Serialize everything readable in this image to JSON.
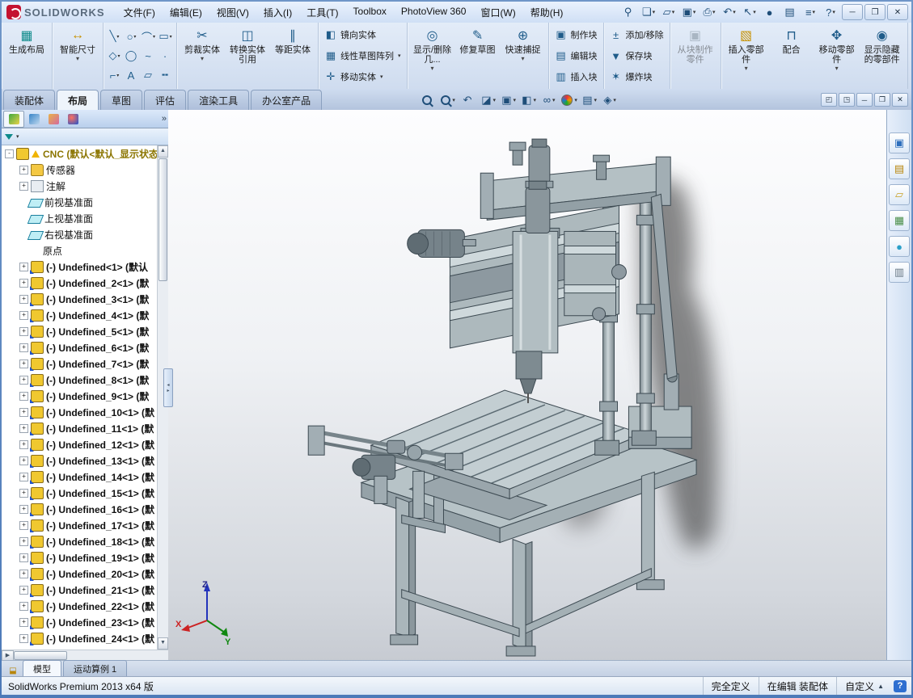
{
  "app": {
    "logo_text": "SOLIDWORKS"
  },
  "menubar": {
    "items": [
      {
        "label": "文件(F)",
        "name": "menu-file"
      },
      {
        "label": "编辑(E)",
        "name": "menu-edit"
      },
      {
        "label": "视图(V)",
        "name": "menu-view"
      },
      {
        "label": "插入(I)",
        "name": "menu-insert"
      },
      {
        "label": "工具(T)",
        "name": "menu-tools"
      },
      {
        "label": "Toolbox",
        "name": "menu-toolbox"
      },
      {
        "label": "PhotoView 360",
        "name": "menu-photoview"
      },
      {
        "label": "窗口(W)",
        "name": "menu-window"
      },
      {
        "label": "帮助(H)",
        "name": "menu-help"
      }
    ],
    "icons": [
      {
        "glyph": "⚲",
        "dd": "",
        "name": "pin-menu-icon"
      },
      {
        "glyph": "❏",
        "dd": "▾",
        "name": "new-document-icon"
      },
      {
        "glyph": "▱",
        "dd": "▾",
        "name": "open-document-icon"
      },
      {
        "glyph": "▣",
        "dd": "▾",
        "name": "save-icon"
      },
      {
        "glyph": "⎙",
        "dd": "▾",
        "name": "print-icon"
      },
      {
        "glyph": "↶",
        "dd": "▾",
        "name": "undo-icon"
      },
      {
        "glyph": "↖",
        "dd": "▾",
        "name": "select-arrow-icon"
      },
      {
        "glyph": "●",
        "dd": "",
        "name": "rebuild-icon"
      },
      {
        "glyph": "▤",
        "dd": "",
        "name": "file-properties-icon"
      },
      {
        "glyph": "≡",
        "dd": "▾",
        "name": "options-icon"
      },
      {
        "glyph": "?",
        "dd": "▾",
        "name": "help-icon"
      }
    ]
  },
  "ribbon": {
    "layout": [
      {
        "label": "生成布局",
        "icon": "▦",
        "iccls": "ict",
        "dd": "",
        "state": "",
        "name": "create-layout-button"
      }
    ],
    "dimension": [
      {
        "label": "智能尺寸",
        "icon": "↔",
        "iccls": "icy",
        "dd": "▾",
        "state": "",
        "name": "smart-dimension-button"
      }
    ],
    "sketch": [
      {
        "icon": "╲",
        "dd": "▾",
        "name": "line-tool"
      },
      {
        "icon": "○",
        "dd": "▾",
        "name": "circle-tool"
      },
      {
        "icon": "⌒",
        "dd": "▾",
        "name": "arc-tool"
      },
      {
        "icon": "▭",
        "dd": "▾",
        "name": "rectangle-tool"
      },
      {
        "icon": "◇",
        "dd": "▾",
        "name": "polygon-tool"
      },
      {
        "icon": "◯",
        "dd": "",
        "name": "ellipse-tool"
      },
      {
        "icon": "~",
        "dd": "",
        "name": "spline-tool"
      },
      {
        "icon": "·",
        "dd": "",
        "name": "point-tool"
      },
      {
        "icon": "⌐",
        "dd": "▾",
        "name": "sketch-fillet-tool"
      },
      {
        "icon": "A",
        "dd": "",
        "name": "text-tool"
      },
      {
        "icon": "▱",
        "dd": "",
        "name": "plane-tool"
      },
      {
        "icon": "╍",
        "dd": "",
        "name": "centerline-tool"
      }
    ],
    "modify": [
      {
        "label": "剪裁实体",
        "icon": "✂",
        "iccls": "",
        "dd": "▾",
        "state": "",
        "name": "trim-entities-button"
      },
      {
        "label": "转换实体引用",
        "icon": "◫",
        "iccls": "",
        "dd": "",
        "state": "",
        "name": "convert-entities-button"
      },
      {
        "label": "等距实体",
        "icon": "∥",
        "iccls": "",
        "dd": "",
        "state": "",
        "name": "offset-entities-button"
      }
    ],
    "pattern": [
      {
        "label": "镜向实体",
        "icon": "◧",
        "dd": "",
        "name": "mirror-entities-button"
      },
      {
        "label": "线性草图阵列",
        "icon": "▦",
        "dd": "▾",
        "name": "linear-sketch-pattern-button"
      },
      {
        "label": "移动实体",
        "icon": "✛",
        "dd": "▾",
        "name": "move-entities-button"
      }
    ],
    "display": [
      {
        "label": "显示/删除几...",
        "icon": "◎",
        "iccls": "",
        "dd": "▾",
        "state": "",
        "name": "display-delete-relations-button"
      },
      {
        "label": "修复草图",
        "icon": "✎",
        "iccls": "",
        "dd": "",
        "state": "",
        "name": "repair-sketch-button"
      },
      {
        "label": "快速捕捉",
        "icon": "⊕",
        "iccls": "",
        "dd": "▾",
        "state": "",
        "name": "quick-snaps-button"
      }
    ],
    "blocks1": [
      {
        "label": "制作块",
        "icon": "▣",
        "dd": "",
        "name": "make-block-button"
      },
      {
        "label": "编辑块",
        "icon": "▤",
        "dd": "",
        "name": "edit-block-button"
      },
      {
        "label": "插入块",
        "icon": "▥",
        "dd": "",
        "name": "insert-block-button"
      }
    ],
    "blocks2": [
      {
        "label": "添加/移除",
        "icon": "±",
        "dd": "",
        "name": "add-remove-button"
      },
      {
        "label": "保存块",
        "icon": "▼",
        "dd": "",
        "name": "save-block-button"
      },
      {
        "label": "爆炸块",
        "icon": "✶",
        "dd": "",
        "name": "explode-block-button"
      }
    ],
    "makepart": [
      {
        "label": "从块制作零件",
        "icon": "▣",
        "iccls": "icg",
        "dd": "",
        "state": "disabled",
        "name": "make-part-from-block-button"
      }
    ],
    "assembly": [
      {
        "label": "插入零部件",
        "icon": "▧",
        "iccls": "icy",
        "dd": "▾",
        "state": "",
        "name": "insert-components-button"
      },
      {
        "label": "配合",
        "icon": "⊓",
        "iccls": "",
        "dd": "",
        "state": "",
        "name": "mate-button"
      },
      {
        "label": "移动零部件",
        "icon": "✥",
        "iccls": "",
        "dd": "▾",
        "state": "",
        "name": "move-component-button"
      },
      {
        "label": "显示隐藏的零部件",
        "icon": "◉",
        "iccls": "",
        "dd": "",
        "state": "",
        "name": "show-hidden-components-button"
      }
    ]
  },
  "tabs": {
    "items": [
      {
        "label": "装配体",
        "state": "",
        "name": "tab-assembly"
      },
      {
        "label": "布局",
        "state": "active",
        "name": "tab-layout"
      },
      {
        "label": "草图",
        "state": "",
        "name": "tab-sketch"
      },
      {
        "label": "评估",
        "state": "",
        "name": "tab-evaluate"
      },
      {
        "label": "渲染工具",
        "state": "",
        "name": "tab-render-tools"
      },
      {
        "label": "办公室产品",
        "state": "",
        "name": "tab-office-products"
      }
    ]
  },
  "headsup": {
    "icons": [
      {
        "iccls": "mag",
        "glyph": "",
        "dd": "",
        "name": "zoom-fit-icon"
      },
      {
        "iccls": "mag",
        "glyph": "",
        "dd": "▾",
        "name": "zoom-area-icon"
      },
      {
        "iccls": "",
        "glyph": "↶",
        "dd": "",
        "name": "previous-view-icon"
      },
      {
        "iccls": "",
        "glyph": "◪",
        "dd": "▾",
        "name": "section-view-icon"
      },
      {
        "iccls": "",
        "glyph": "▣",
        "dd": "▾",
        "name": "view-orientation-icon"
      },
      {
        "iccls": "",
        "glyph": "◧",
        "dd": "▾",
        "name": "display-style-icon"
      },
      {
        "iccls": "",
        "glyph": "∞",
        "dd": "▾",
        "name": "hide-show-items-icon"
      },
      {
        "iccls": "ball",
        "glyph": "",
        "dd": "▾",
        "name": "edit-appearance-icon"
      },
      {
        "iccls": "",
        "glyph": "▤",
        "dd": "▾",
        "name": "apply-scene-icon"
      },
      {
        "iccls": "",
        "glyph": "◈",
        "dd": "▾",
        "name": "view-settings-icon"
      }
    ],
    "doc_controls": [
      {
        "glyph": "◰",
        "name": "split-pane-left-button"
      },
      {
        "glyph": "◳",
        "name": "split-pane-right-button"
      },
      {
        "glyph": "─",
        "name": "minimize-document-button"
      },
      {
        "glyph": "❐",
        "name": "restore-document-button"
      },
      {
        "glyph": "✕",
        "name": "close-document-button"
      }
    ]
  },
  "featuretree": {
    "root": "CNC (默认<默认_显示状态",
    "root_exp": "-",
    "items": [
      {
        "label": "传感器",
        "icon": "ic-sensors",
        "exp": "+",
        "cls": "",
        "name": "tree-item-sensors"
      },
      {
        "label": "注解",
        "icon": "ic-ann",
        "exp": "+",
        "cls": "",
        "name": "tree-item-annotations"
      },
      {
        "label": "前视基准面",
        "icon": "ic-plane",
        "exp": "",
        "cls": "",
        "name": "tree-item-front-plane"
      },
      {
        "label": "上视基准面",
        "icon": "ic-plane",
        "exp": "",
        "cls": "",
        "name": "tree-item-top-plane"
      },
      {
        "label": "右视基准面",
        "icon": "ic-plane",
        "exp": "",
        "cls": "",
        "name": "tree-item-right-plane"
      },
      {
        "label": "原点",
        "icon": "ic-origin",
        "exp": "",
        "cls": "",
        "name": "tree-item-origin"
      },
      {
        "label": "(-) Undefined<1> (默认",
        "icon": "ic-comp",
        "exp": "+",
        "cls": "comp",
        "name": "tree-item-component"
      },
      {
        "label": "(-) Undefined_2<1> (默",
        "icon": "ic-comp",
        "exp": "+",
        "cls": "comp",
        "name": "tree-item-component"
      },
      {
        "label": "(-) Undefined_3<1> (默",
        "icon": "ic-comp",
        "exp": "+",
        "cls": "comp",
        "name": "tree-item-component"
      },
      {
        "label": "(-) Undefined_4<1> (默",
        "icon": "ic-comp",
        "exp": "+",
        "cls": "comp",
        "name": "tree-item-component"
      },
      {
        "label": "(-) Undefined_5<1> (默",
        "icon": "ic-comp",
        "exp": "+",
        "cls": "comp",
        "name": "tree-item-component"
      },
      {
        "label": "(-) Undefined_6<1> (默",
        "icon": "ic-comp",
        "exp": "+",
        "cls": "comp",
        "name": "tree-item-component"
      },
      {
        "label": "(-) Undefined_7<1> (默",
        "icon": "ic-comp",
        "exp": "+",
        "cls": "comp",
        "name": "tree-item-component"
      },
      {
        "label": "(-) Undefined_8<1> (默",
        "icon": "ic-comp",
        "exp": "+",
        "cls": "comp",
        "name": "tree-item-component"
      },
      {
        "label": "(-) Undefined_9<1> (默",
        "icon": "ic-comp",
        "exp": "+",
        "cls": "comp",
        "name": "tree-item-component"
      },
      {
        "label": "(-) Undefined_10<1> (默",
        "icon": "ic-comp",
        "exp": "+",
        "cls": "comp",
        "name": "tree-item-component"
      },
      {
        "label": "(-) Undefined_11<1> (默",
        "icon": "ic-comp",
        "exp": "+",
        "cls": "comp",
        "name": "tree-item-component"
      },
      {
        "label": "(-) Undefined_12<1> (默",
        "icon": "ic-comp",
        "exp": "+",
        "cls": "comp",
        "name": "tree-item-component"
      },
      {
        "label": "(-) Undefined_13<1> (默",
        "icon": "ic-comp",
        "exp": "+",
        "cls": "comp",
        "name": "tree-item-component"
      },
      {
        "label": "(-) Undefined_14<1> (默",
        "icon": "ic-comp",
        "exp": "+",
        "cls": "comp",
        "name": "tree-item-component"
      },
      {
        "label": "(-) Undefined_15<1> (默",
        "icon": "ic-comp",
        "exp": "+",
        "cls": "comp",
        "name": "tree-item-component"
      },
      {
        "label": "(-) Undefined_16<1> (默",
        "icon": "ic-comp",
        "exp": "+",
        "cls": "comp",
        "name": "tree-item-component"
      },
      {
        "label": "(-) Undefined_17<1> (默",
        "icon": "ic-comp",
        "exp": "+",
        "cls": "comp",
        "name": "tree-item-component"
      },
      {
        "label": "(-) Undefined_18<1> (默",
        "icon": "ic-comp",
        "exp": "+",
        "cls": "comp",
        "name": "tree-item-component"
      },
      {
        "label": "(-) Undefined_19<1> (默",
        "icon": "ic-comp",
        "exp": "+",
        "cls": "comp",
        "name": "tree-item-component"
      },
      {
        "label": "(-) Undefined_20<1> (默",
        "icon": "ic-comp",
        "exp": "+",
        "cls": "comp",
        "name": "tree-item-component"
      },
      {
        "label": "(-) Undefined_21<1> (默",
        "icon": "ic-comp",
        "exp": "+",
        "cls": "comp",
        "name": "tree-item-component"
      },
      {
        "label": "(-) Undefined_22<1> (默",
        "icon": "ic-comp",
        "exp": "+",
        "cls": "comp",
        "name": "tree-item-component"
      },
      {
        "label": "(-) Undefined_23<1> (默",
        "icon": "ic-comp",
        "exp": "+",
        "cls": "comp",
        "name": "tree-item-component"
      },
      {
        "label": "(-) Undefined_24<1> (默",
        "icon": "ic-comp",
        "exp": "+",
        "cls": "comp",
        "name": "tree-item-component"
      }
    ]
  },
  "taskpane": {
    "icons": [
      {
        "glyph": "▣",
        "color": "#2e6fbd",
        "name": "task-resources-icon"
      },
      {
        "glyph": "▤",
        "color": "#b8860b",
        "name": "task-design-library-icon"
      },
      {
        "glyph": "▱",
        "color": "#c9a227",
        "name": "task-file-explorer-icon"
      },
      {
        "glyph": "▦",
        "color": "#4a8f4a",
        "name": "task-view-palette-icon"
      },
      {
        "glyph": "●",
        "color": "#2aa0c8",
        "name": "task-appearances-icon"
      },
      {
        "glyph": "▥",
        "color": "#6a7a86",
        "name": "task-custom-properties-icon"
      }
    ]
  },
  "viewport": {
    "triad": {
      "x": "X",
      "y": "Y",
      "z": "Z"
    }
  },
  "motion": {
    "tabs": [
      {
        "label": "模型",
        "state": "active",
        "name": "tab-model"
      },
      {
        "label": "运动算例 1",
        "state": "",
        "name": "tab-motion-study-1"
      }
    ]
  },
  "statusbar": {
    "left": "SolidWorks Premium 2013 x64 版",
    "fully_defined": "完全定义",
    "editing": "在编辑 装配体",
    "custom": "自定义"
  }
}
